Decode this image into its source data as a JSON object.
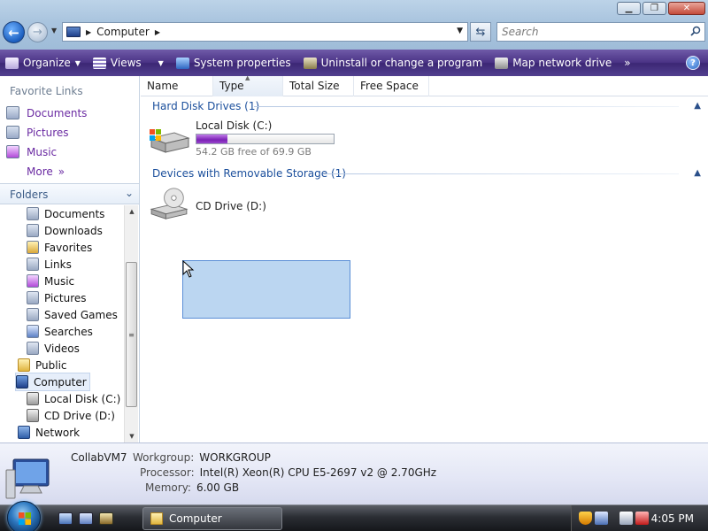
{
  "window": {
    "buttons": {
      "minimize": "▁",
      "maximize": "❐",
      "close": "✕"
    }
  },
  "address": {
    "path_root_icon": "computer-icon",
    "location": "Computer",
    "search_placeholder": "Search"
  },
  "toolbar": {
    "items": [
      {
        "label": "Organize",
        "icon": "organize-icon"
      },
      {
        "label": "Views",
        "icon": "views-icon"
      },
      {
        "label": "System properties",
        "icon": "system-properties-icon"
      },
      {
        "label": "Uninstall or change a program",
        "icon": "uninstall-icon"
      },
      {
        "label": "Map network drive",
        "icon": "map-drive-icon"
      }
    ],
    "overflow": "»",
    "help": "?"
  },
  "favorites": {
    "title": "Favorite Links",
    "items": [
      "Documents",
      "Pictures",
      "Music"
    ],
    "more": "More",
    "more_chevron": "»"
  },
  "folders": {
    "title": "Folders",
    "tree": [
      {
        "label": "Documents",
        "icon": "documents-icon"
      },
      {
        "label": "Downloads",
        "icon": "downloads-icon"
      },
      {
        "label": "Favorites",
        "icon": "favorites-icon"
      },
      {
        "label": "Links",
        "icon": "links-icon"
      },
      {
        "label": "Music",
        "icon": "music-icon"
      },
      {
        "label": "Pictures",
        "icon": "pictures-icon"
      },
      {
        "label": "Saved Games",
        "icon": "saved-games-icon"
      },
      {
        "label": "Searches",
        "icon": "searches-icon"
      },
      {
        "label": "Videos",
        "icon": "videos-icon"
      },
      {
        "label": "Public",
        "icon": "folder-icon"
      },
      {
        "label": "Computer",
        "icon": "computer-icon",
        "selected": true
      },
      {
        "label": "Local Disk (C:)",
        "icon": "hard-drive-icon"
      },
      {
        "label": "CD Drive (D:)",
        "icon": "cd-drive-icon"
      },
      {
        "label": "Network",
        "icon": "network-icon"
      }
    ]
  },
  "columns": [
    "Name",
    "Type",
    "Total Size",
    "Free Space"
  ],
  "groups": {
    "hard_disks": {
      "title": "Hard Disk Drives (1)",
      "drive_name": "Local Disk (C:)",
      "free_text": "54.2 GB free of 69.9 GB",
      "used_fraction": 0.225
    },
    "removable": {
      "title": "Devices with Removable Storage (1)",
      "drive_name": "CD Drive (D:)"
    },
    "collapse_glyph": "▲"
  },
  "details": {
    "name": "CollabVM7",
    "workgroup_label": "Workgroup:",
    "workgroup": "WORKGROUP",
    "processor_label": "Processor:",
    "processor": "Intel(R) Xeon(R) CPU E5-2697 v2 @ 2.70GHz",
    "memory_label": "Memory:",
    "memory": "6.00 GB"
  },
  "taskbar": {
    "task_label": "Computer",
    "clock": "4:05 PM"
  },
  "colors": {
    "toolbar_purple": "#4b3486",
    "link_purple": "#6a2aa2",
    "group_blue": "#1b4f9c",
    "capacity_fill": "#7b22b5",
    "selection": "#84b4e6"
  }
}
